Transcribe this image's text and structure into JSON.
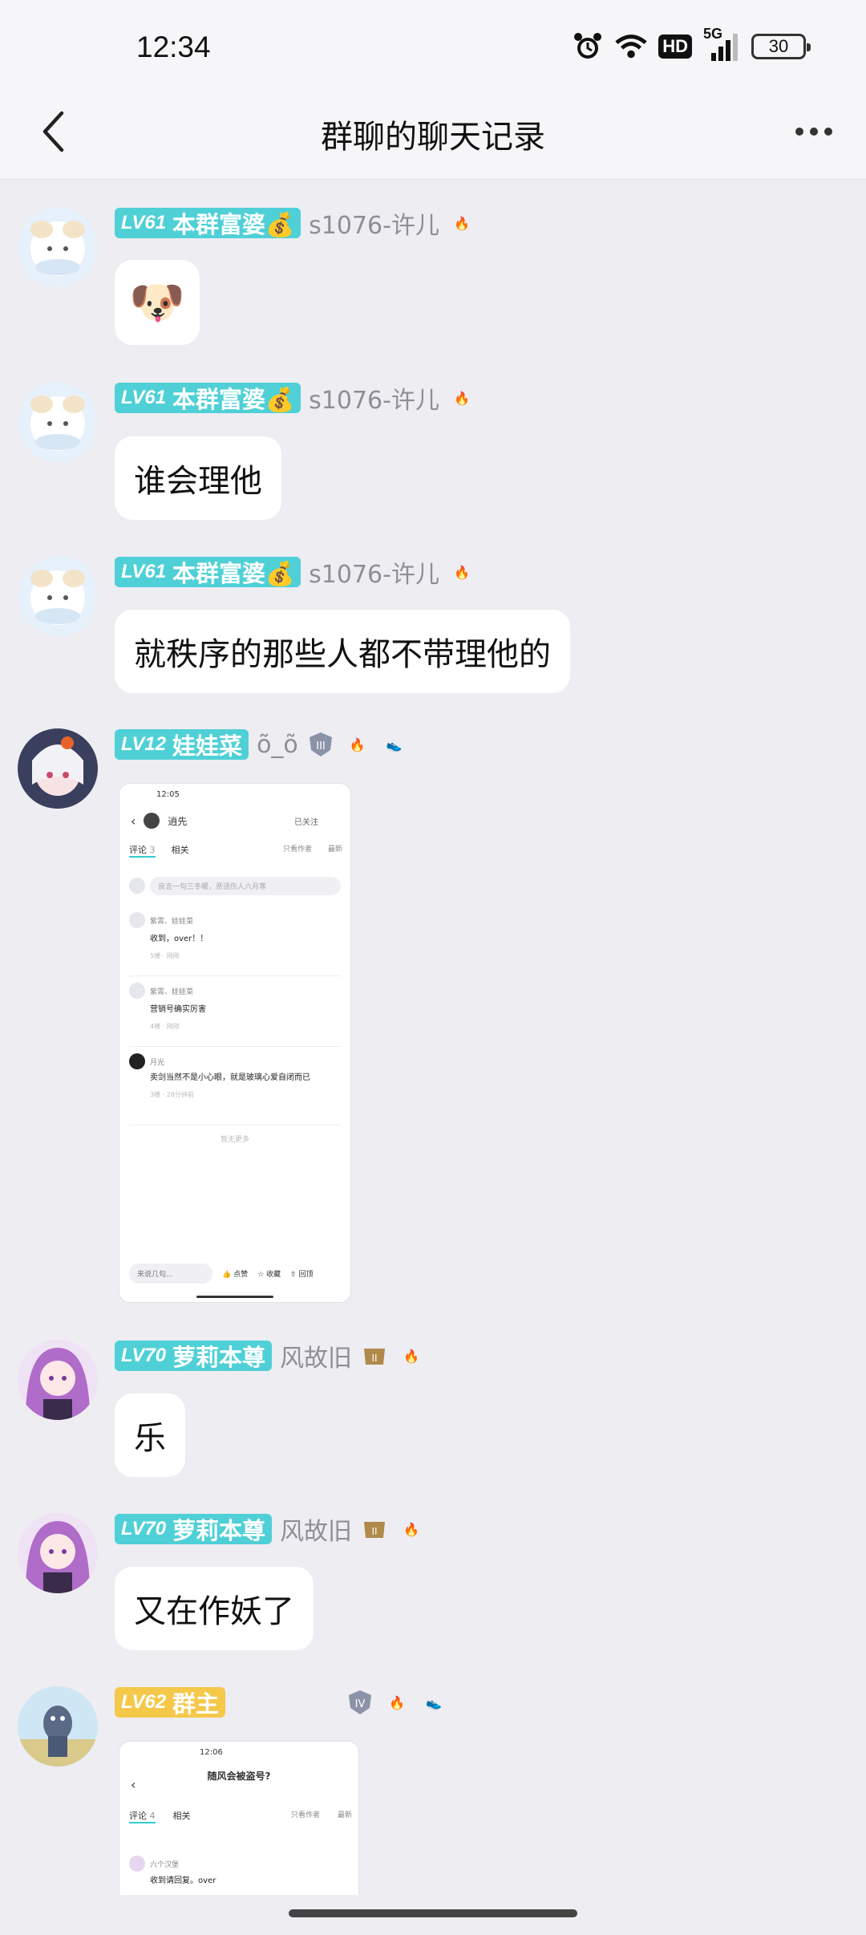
{
  "status_bar": {
    "time": "12:34",
    "hd": "HD",
    "net": "5G",
    "battery": "30"
  },
  "header": {
    "title": "群聊的聊天记录"
  },
  "messages": [
    {
      "level": "LV61",
      "tag": "本群富婆💰",
      "name": "s1076-许儿",
      "content_type": "emoji",
      "emoji": "🐶"
    },
    {
      "level": "LV61",
      "tag": "本群富婆💰",
      "name": "s1076-许儿",
      "text": "谁会理他"
    },
    {
      "level": "LV61",
      "tag": "本群富婆💰",
      "name": "s1076-许儿",
      "text": "就秩序的那些人都不带理他的"
    },
    {
      "level": "LV12",
      "tag": "娃娃菜",
      "name": "õ_õ",
      "content_type": "image"
    },
    {
      "level": "LV70",
      "tag": "萝莉本尊",
      "name": "风故旧",
      "text": "乐"
    },
    {
      "level": "LV70",
      "tag": "萝莉本尊",
      "name": "风故旧",
      "text": "又在作妖了"
    },
    {
      "level": "LV62",
      "tag": "群主",
      "name": "",
      "content_type": "image"
    }
  ],
  "shot1": {
    "time": "12:05",
    "user": "逍先",
    "follow": "已关注",
    "tab_comment": "评论",
    "tab_comment_count": "3",
    "tab_related": "相关",
    "author_only": "只看作者",
    "newest": "最新",
    "input_placeholder": "良言一句三冬暖，恶语伤人六月寒",
    "comments": [
      {
        "user": "紫霄、娃娃菜",
        "text": "收到，over！！",
        "meta": "5楼 · 刚刚"
      },
      {
        "user": "紫霄、娃娃菜",
        "text": "营销号确实厉害",
        "meta": "4楼 · 刚刚"
      },
      {
        "user": "月光",
        "text": "卖剑当然不是小心眼，就是玻璃心爱自闭而已",
        "meta": "3楼 · 28分钟前"
      }
    ],
    "no_more": "暂无更多",
    "bottom_input": "来说几句...",
    "like": "点赞",
    "fav": "收藏",
    "share": "回顶"
  },
  "shot2": {
    "time": "12:06",
    "title": "随风会被盗号?",
    "tab_comment": "评论",
    "tab_comment_count": "4",
    "tab_related": "相关",
    "author_only": "只看作者",
    "newest": "最新",
    "comment_user": "六个汉堡",
    "comment_text": "收到请回复。over"
  },
  "colors": {
    "level_cyan": "#4fd0d6",
    "level_gold": "#f5c84a",
    "background": "#ededf2"
  }
}
